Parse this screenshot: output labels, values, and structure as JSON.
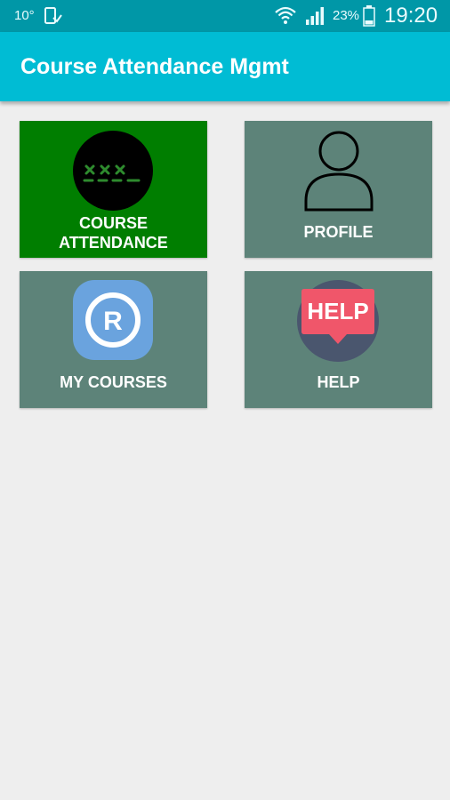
{
  "status_bar": {
    "temperature": "10°",
    "battery_percent": "23%",
    "time": "19:20"
  },
  "app_bar": {
    "title": "Course Attendance Mgmt"
  },
  "tiles": [
    {
      "label": "COURSE\nATTENDANCE",
      "line1": "COURSE",
      "line2": "ATTENDANCE",
      "icon": "attendance-icon",
      "color": "#007e00"
    },
    {
      "label": "PROFILE",
      "icon": "person-icon",
      "color": "#5d8379"
    },
    {
      "label": "MY COURSES",
      "icon": "registered-icon",
      "color": "#5d8379"
    },
    {
      "label": "HELP",
      "icon": "help-icon",
      "icon_text": "HELP",
      "color": "#5d8379"
    }
  ],
  "colors": {
    "status_bar": "#0097a7",
    "app_bar": "#00bcd4",
    "tile_default": "#5d8379",
    "tile_active": "#007e00",
    "background": "#eeeeee"
  }
}
